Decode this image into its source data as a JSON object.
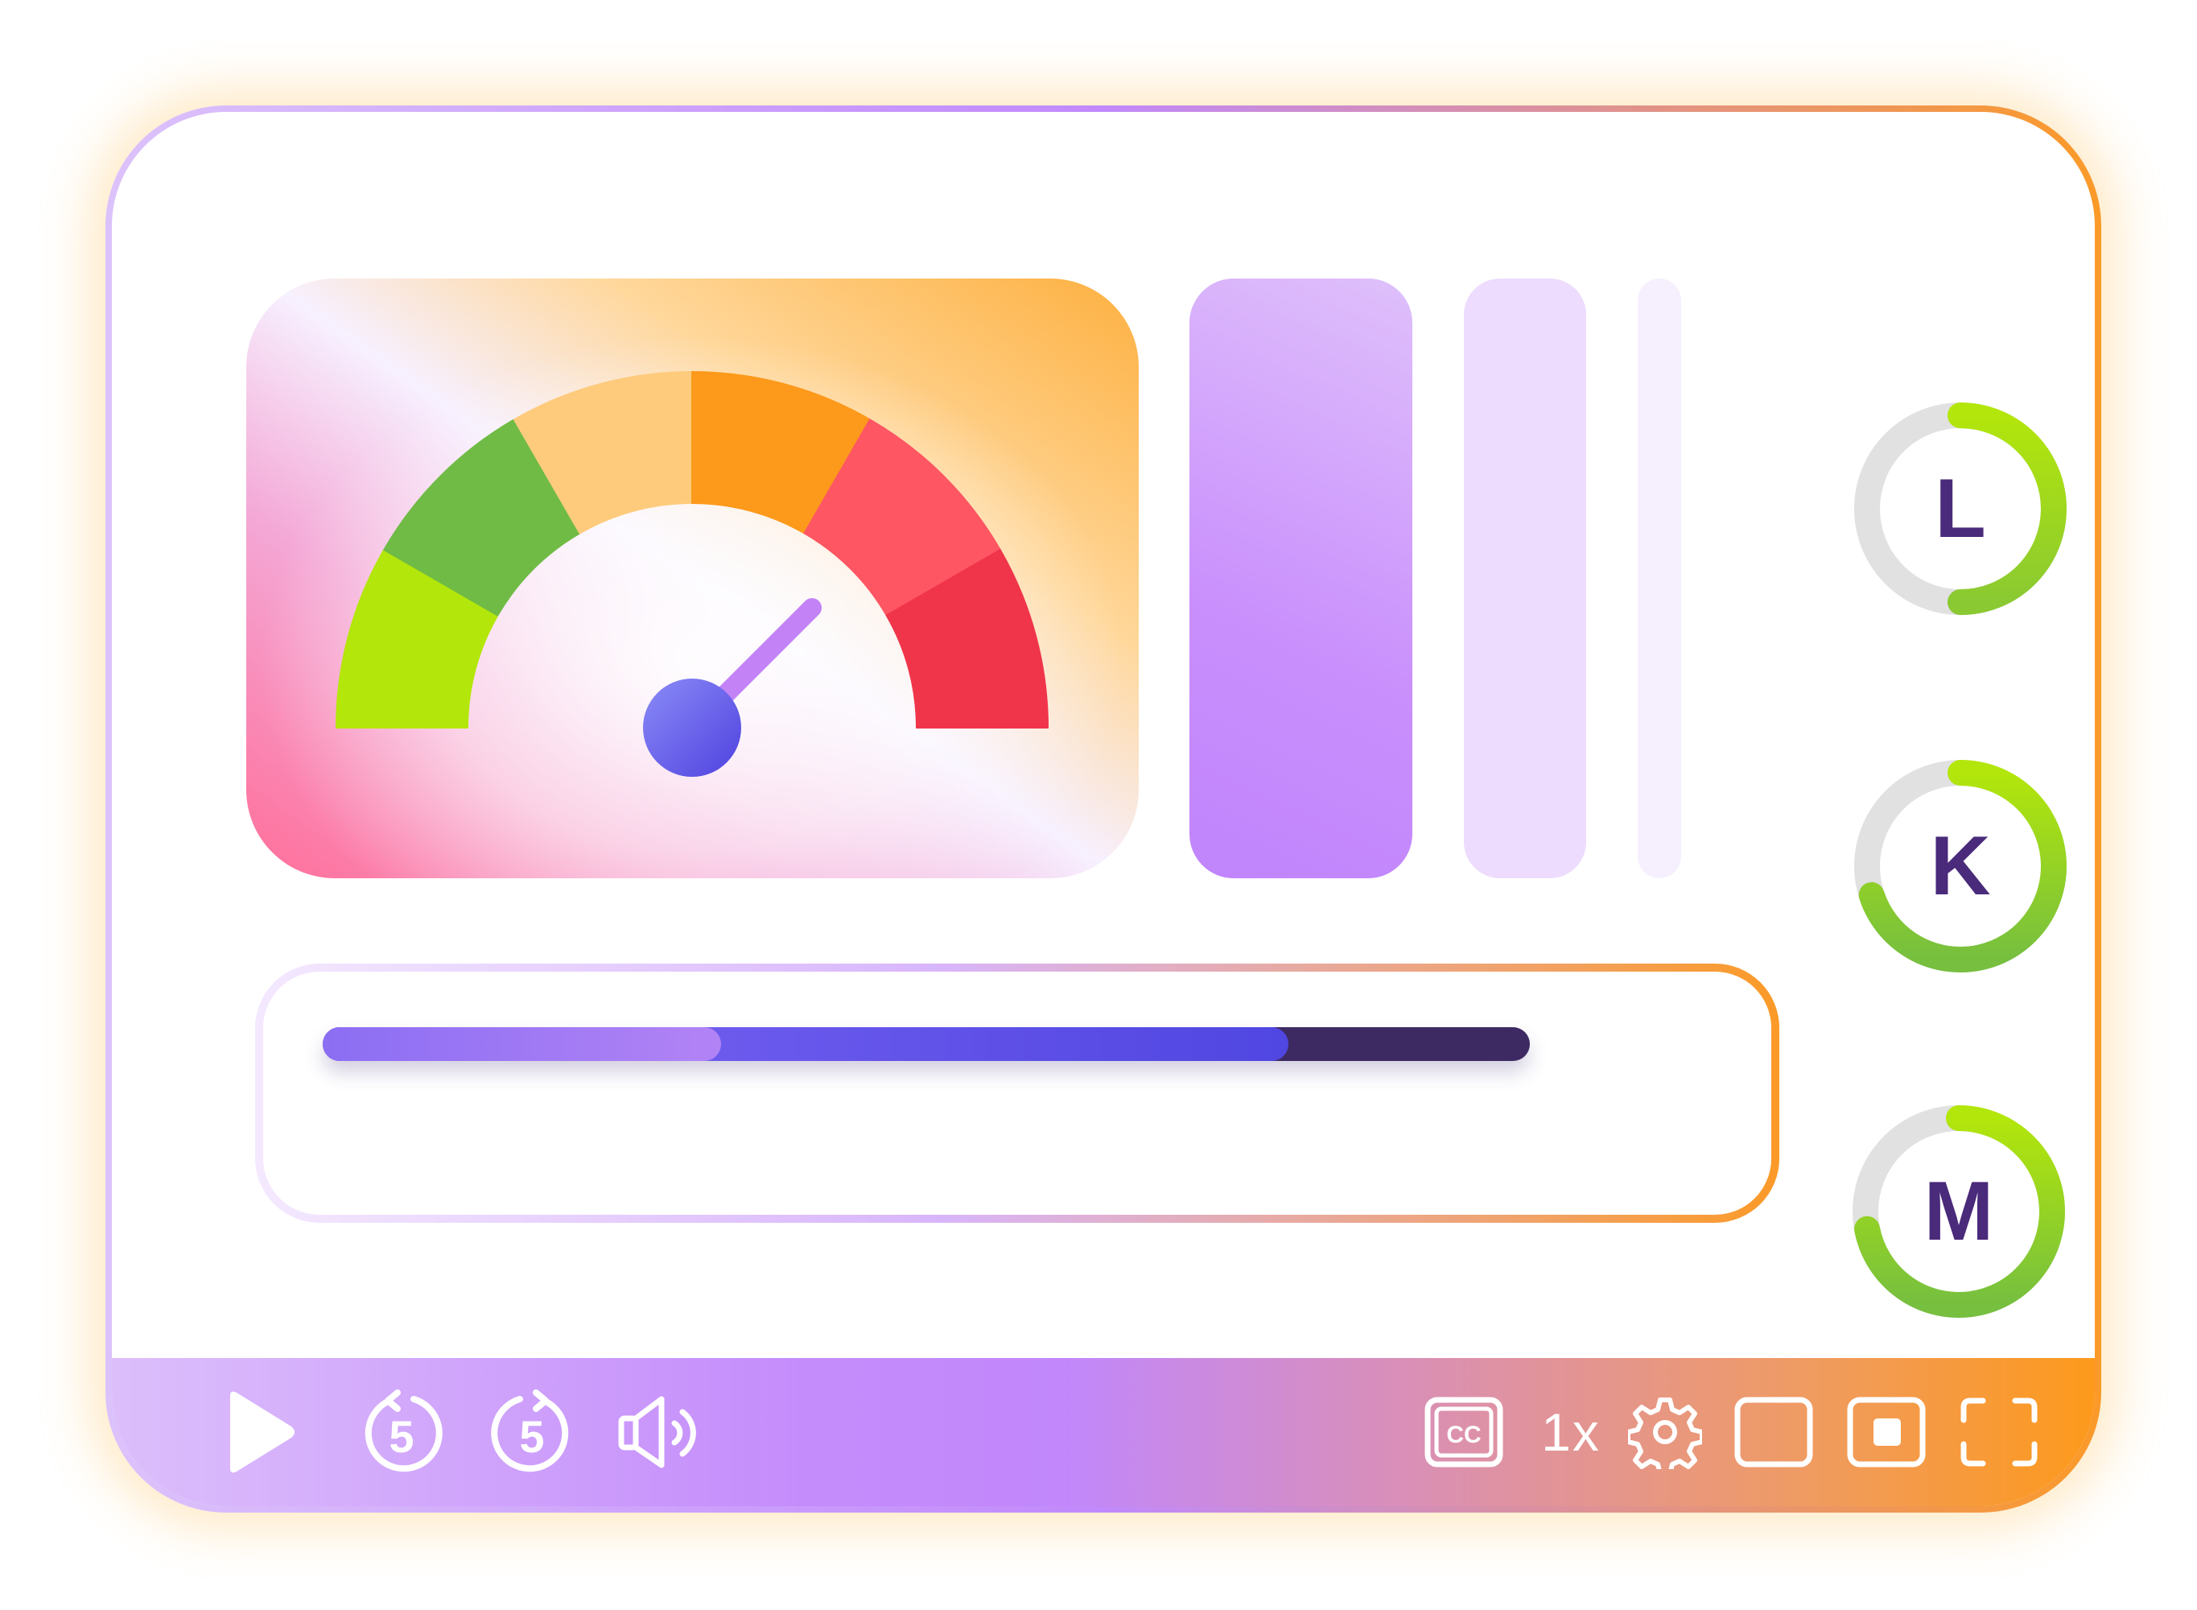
{
  "gauge": {
    "segment_colors": [
      "#b3e60b",
      "#70bb46",
      "#fecb7d",
      "#fd991b",
      "#fe5663",
      "#f0354b"
    ],
    "needle_color": "#c383f7",
    "hub_gradient": [
      "#8b8cf7",
      "#4f41df"
    ]
  },
  "side_bars": {
    "levels": [
      1.0,
      1.0,
      1.0
    ],
    "colors": [
      "#c98ffc",
      "#eddcfd",
      "#f6f0fe"
    ]
  },
  "rings": [
    {
      "letter": "L",
      "progress": 0.5,
      "accent": "#8ac932"
    },
    {
      "letter": "K",
      "progress": 0.7,
      "accent": "#76bf3f"
    },
    {
      "letter": "M",
      "progress": 0.72,
      "accent": "#76bf3f"
    }
  ],
  "playback": {
    "played_fraction": 0.8,
    "buffered_fraction": 0.33
  },
  "controls": {
    "speed_label": "1x",
    "rewind_seconds": "5",
    "forward_seconds": "5",
    "captions_label": "CC"
  }
}
